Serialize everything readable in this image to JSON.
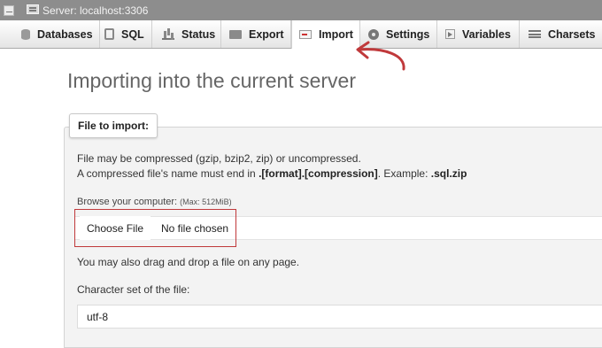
{
  "titlebar": {
    "title": "Server: localhost:3306"
  },
  "tabs": [
    {
      "label": "Databases",
      "icon": "database-icon"
    },
    {
      "label": "SQL",
      "icon": "sql-icon"
    },
    {
      "label": "Status",
      "icon": "status-icon"
    },
    {
      "label": "Export",
      "icon": "export-icon"
    },
    {
      "label": "Import",
      "icon": "import-icon",
      "active": true
    },
    {
      "label": "Settings",
      "icon": "settings-icon"
    },
    {
      "label": "Variables",
      "icon": "variables-icon"
    },
    {
      "label": "Charsets",
      "icon": "charsets-icon"
    }
  ],
  "main": {
    "heading": "Importing into the current server",
    "file_section": {
      "legend": "File to import:",
      "compress_note": "File may be compressed (gzip, bzip2, zip) or uncompressed.",
      "name_note_prefix": "A compressed file's name must end in ",
      "name_note_format": ".[format].[compression]",
      "name_note_middle": ". Example: ",
      "name_note_example": ".sql.zip",
      "browse_label": "Browse your computer: ",
      "browse_max": "(Max: 512MiB)",
      "choose_button": "Choose File",
      "no_file": "No file chosen",
      "drag_note": "You may also drag and drop a file on any page.",
      "charset_label": "Character set of the file:",
      "charset_value": "utf-8"
    }
  },
  "colors": {
    "annotation": "#c0393b",
    "title_bar": "#8d8d8d"
  }
}
